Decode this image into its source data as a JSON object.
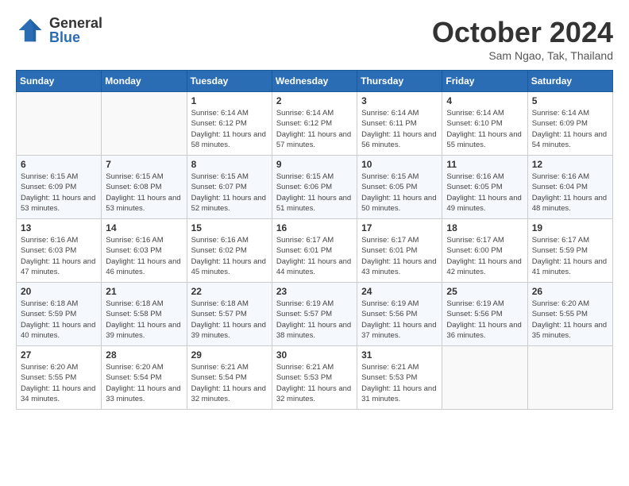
{
  "header": {
    "logo": {
      "general": "General",
      "blue": "Blue"
    },
    "title": "October 2024",
    "location": "Sam Ngao, Tak, Thailand"
  },
  "weekdays": [
    "Sunday",
    "Monday",
    "Tuesday",
    "Wednesday",
    "Thursday",
    "Friday",
    "Saturday"
  ],
  "weeks": [
    [
      {
        "day": "",
        "info": ""
      },
      {
        "day": "",
        "info": ""
      },
      {
        "day": "1",
        "info": "Sunrise: 6:14 AM\nSunset: 6:12 PM\nDaylight: 11 hours and 58 minutes."
      },
      {
        "day": "2",
        "info": "Sunrise: 6:14 AM\nSunset: 6:12 PM\nDaylight: 11 hours and 57 minutes."
      },
      {
        "day": "3",
        "info": "Sunrise: 6:14 AM\nSunset: 6:11 PM\nDaylight: 11 hours and 56 minutes."
      },
      {
        "day": "4",
        "info": "Sunrise: 6:14 AM\nSunset: 6:10 PM\nDaylight: 11 hours and 55 minutes."
      },
      {
        "day": "5",
        "info": "Sunrise: 6:14 AM\nSunset: 6:09 PM\nDaylight: 11 hours and 54 minutes."
      }
    ],
    [
      {
        "day": "6",
        "info": "Sunrise: 6:15 AM\nSunset: 6:09 PM\nDaylight: 11 hours and 53 minutes."
      },
      {
        "day": "7",
        "info": "Sunrise: 6:15 AM\nSunset: 6:08 PM\nDaylight: 11 hours and 53 minutes."
      },
      {
        "day": "8",
        "info": "Sunrise: 6:15 AM\nSunset: 6:07 PM\nDaylight: 11 hours and 52 minutes."
      },
      {
        "day": "9",
        "info": "Sunrise: 6:15 AM\nSunset: 6:06 PM\nDaylight: 11 hours and 51 minutes."
      },
      {
        "day": "10",
        "info": "Sunrise: 6:15 AM\nSunset: 6:05 PM\nDaylight: 11 hours and 50 minutes."
      },
      {
        "day": "11",
        "info": "Sunrise: 6:16 AM\nSunset: 6:05 PM\nDaylight: 11 hours and 49 minutes."
      },
      {
        "day": "12",
        "info": "Sunrise: 6:16 AM\nSunset: 6:04 PM\nDaylight: 11 hours and 48 minutes."
      }
    ],
    [
      {
        "day": "13",
        "info": "Sunrise: 6:16 AM\nSunset: 6:03 PM\nDaylight: 11 hours and 47 minutes."
      },
      {
        "day": "14",
        "info": "Sunrise: 6:16 AM\nSunset: 6:03 PM\nDaylight: 11 hours and 46 minutes."
      },
      {
        "day": "15",
        "info": "Sunrise: 6:16 AM\nSunset: 6:02 PM\nDaylight: 11 hours and 45 minutes."
      },
      {
        "day": "16",
        "info": "Sunrise: 6:17 AM\nSunset: 6:01 PM\nDaylight: 11 hours and 44 minutes."
      },
      {
        "day": "17",
        "info": "Sunrise: 6:17 AM\nSunset: 6:01 PM\nDaylight: 11 hours and 43 minutes."
      },
      {
        "day": "18",
        "info": "Sunrise: 6:17 AM\nSunset: 6:00 PM\nDaylight: 11 hours and 42 minutes."
      },
      {
        "day": "19",
        "info": "Sunrise: 6:17 AM\nSunset: 5:59 PM\nDaylight: 11 hours and 41 minutes."
      }
    ],
    [
      {
        "day": "20",
        "info": "Sunrise: 6:18 AM\nSunset: 5:59 PM\nDaylight: 11 hours and 40 minutes."
      },
      {
        "day": "21",
        "info": "Sunrise: 6:18 AM\nSunset: 5:58 PM\nDaylight: 11 hours and 39 minutes."
      },
      {
        "day": "22",
        "info": "Sunrise: 6:18 AM\nSunset: 5:57 PM\nDaylight: 11 hours and 39 minutes."
      },
      {
        "day": "23",
        "info": "Sunrise: 6:19 AM\nSunset: 5:57 PM\nDaylight: 11 hours and 38 minutes."
      },
      {
        "day": "24",
        "info": "Sunrise: 6:19 AM\nSunset: 5:56 PM\nDaylight: 11 hours and 37 minutes."
      },
      {
        "day": "25",
        "info": "Sunrise: 6:19 AM\nSunset: 5:56 PM\nDaylight: 11 hours and 36 minutes."
      },
      {
        "day": "26",
        "info": "Sunrise: 6:20 AM\nSunset: 5:55 PM\nDaylight: 11 hours and 35 minutes."
      }
    ],
    [
      {
        "day": "27",
        "info": "Sunrise: 6:20 AM\nSunset: 5:55 PM\nDaylight: 11 hours and 34 minutes."
      },
      {
        "day": "28",
        "info": "Sunrise: 6:20 AM\nSunset: 5:54 PM\nDaylight: 11 hours and 33 minutes."
      },
      {
        "day": "29",
        "info": "Sunrise: 6:21 AM\nSunset: 5:54 PM\nDaylight: 11 hours and 32 minutes."
      },
      {
        "day": "30",
        "info": "Sunrise: 6:21 AM\nSunset: 5:53 PM\nDaylight: 11 hours and 32 minutes."
      },
      {
        "day": "31",
        "info": "Sunrise: 6:21 AM\nSunset: 5:53 PM\nDaylight: 11 hours and 31 minutes."
      },
      {
        "day": "",
        "info": ""
      },
      {
        "day": "",
        "info": ""
      }
    ]
  ]
}
